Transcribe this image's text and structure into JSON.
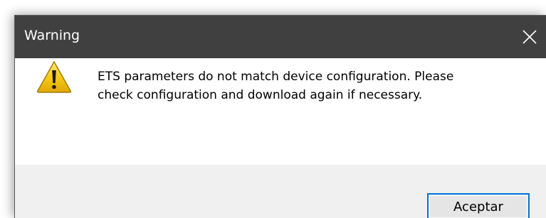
{
  "dialog": {
    "title": "Warning",
    "close_icon": "close-icon",
    "message_line1": "ETS parameters do not match device configuration. Please",
    "message_line2": "check configuration and download again if necessary.",
    "icon": "warning-icon",
    "ok_label": "Aceptar"
  },
  "colors": {
    "titlebar": "#404040",
    "footer": "#f0f0f0",
    "button_border": "#0078d7",
    "button_bg": "#e5e5e5",
    "warning_fill": "#f5c400"
  }
}
